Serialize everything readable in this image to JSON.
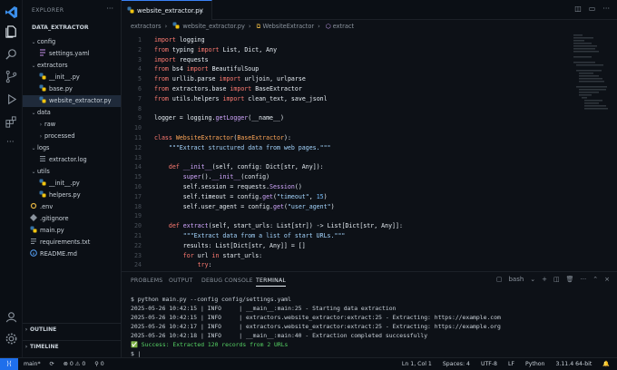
{
  "sidebar": {
    "title": "EXPLORER",
    "more": "···",
    "root": "DATA_EXTRACTOR",
    "items": [
      {
        "label": "config"
      },
      {
        "label": "settings.yaml"
      },
      {
        "label": "extractors"
      },
      {
        "label": "__init__.py"
      },
      {
        "label": "base.py"
      },
      {
        "label": "website_extractor.py"
      },
      {
        "label": "data"
      },
      {
        "label": "raw"
      },
      {
        "label": "processed"
      },
      {
        "label": "logs"
      },
      {
        "label": "extractor.log"
      },
      {
        "label": "utils"
      },
      {
        "label": "__init__.py"
      },
      {
        "label": "helpers.py"
      },
      {
        "label": ".env"
      },
      {
        "label": ".gitignore"
      },
      {
        "label": "main.py"
      },
      {
        "label": "requirements.txt"
      },
      {
        "label": "README.md"
      }
    ],
    "outline": "OUTLINE",
    "timeline": "TIMELINE"
  },
  "tab": {
    "label": "website_extractor.py",
    "close": "×"
  },
  "breadcrumb": {
    "parts": [
      "extractors",
      "website_extractor.py",
      "WebsiteExtractor",
      "extract"
    ]
  },
  "panel": {
    "tabs": [
      "PROBLEMS",
      "OUTPUT",
      "DEBUG CONSOLE",
      "TERMINAL"
    ],
    "shell": "bash",
    "terminal": [
      "$ python main.py --config config/settings.yaml",
      "2025-05-26 10:42:15 | INFO     | __main__:main:25 - Starting data extraction",
      "2025-05-26 10:42:15 | INFO     | extractors.website_extractor:extract:25 - Extracting: https://example.com",
      "2025-05-26 10:42:17 | INFO     | extractors.website_extractor:extract:25 - Extracting: https://example.org",
      "2025-05-26 10:42:18 | INFO     | __main__:main:40 - Extraction completed successfully",
      "✅ Success: Extracted 120 records from 2 URLs",
      "$ |"
    ]
  },
  "status": {
    "branch": "main*",
    "sync": "⟳",
    "errors": "⊗ 0 ⚠ 0",
    "ports": "⚲ 0",
    "position": "Ln 1, Col 1",
    "spaces": "Spaces: 4",
    "encoding": "UTF-8",
    "eol": "LF",
    "language": "Python",
    "interpreter": "3.11.4 64-bit",
    "bell": "🔔"
  }
}
